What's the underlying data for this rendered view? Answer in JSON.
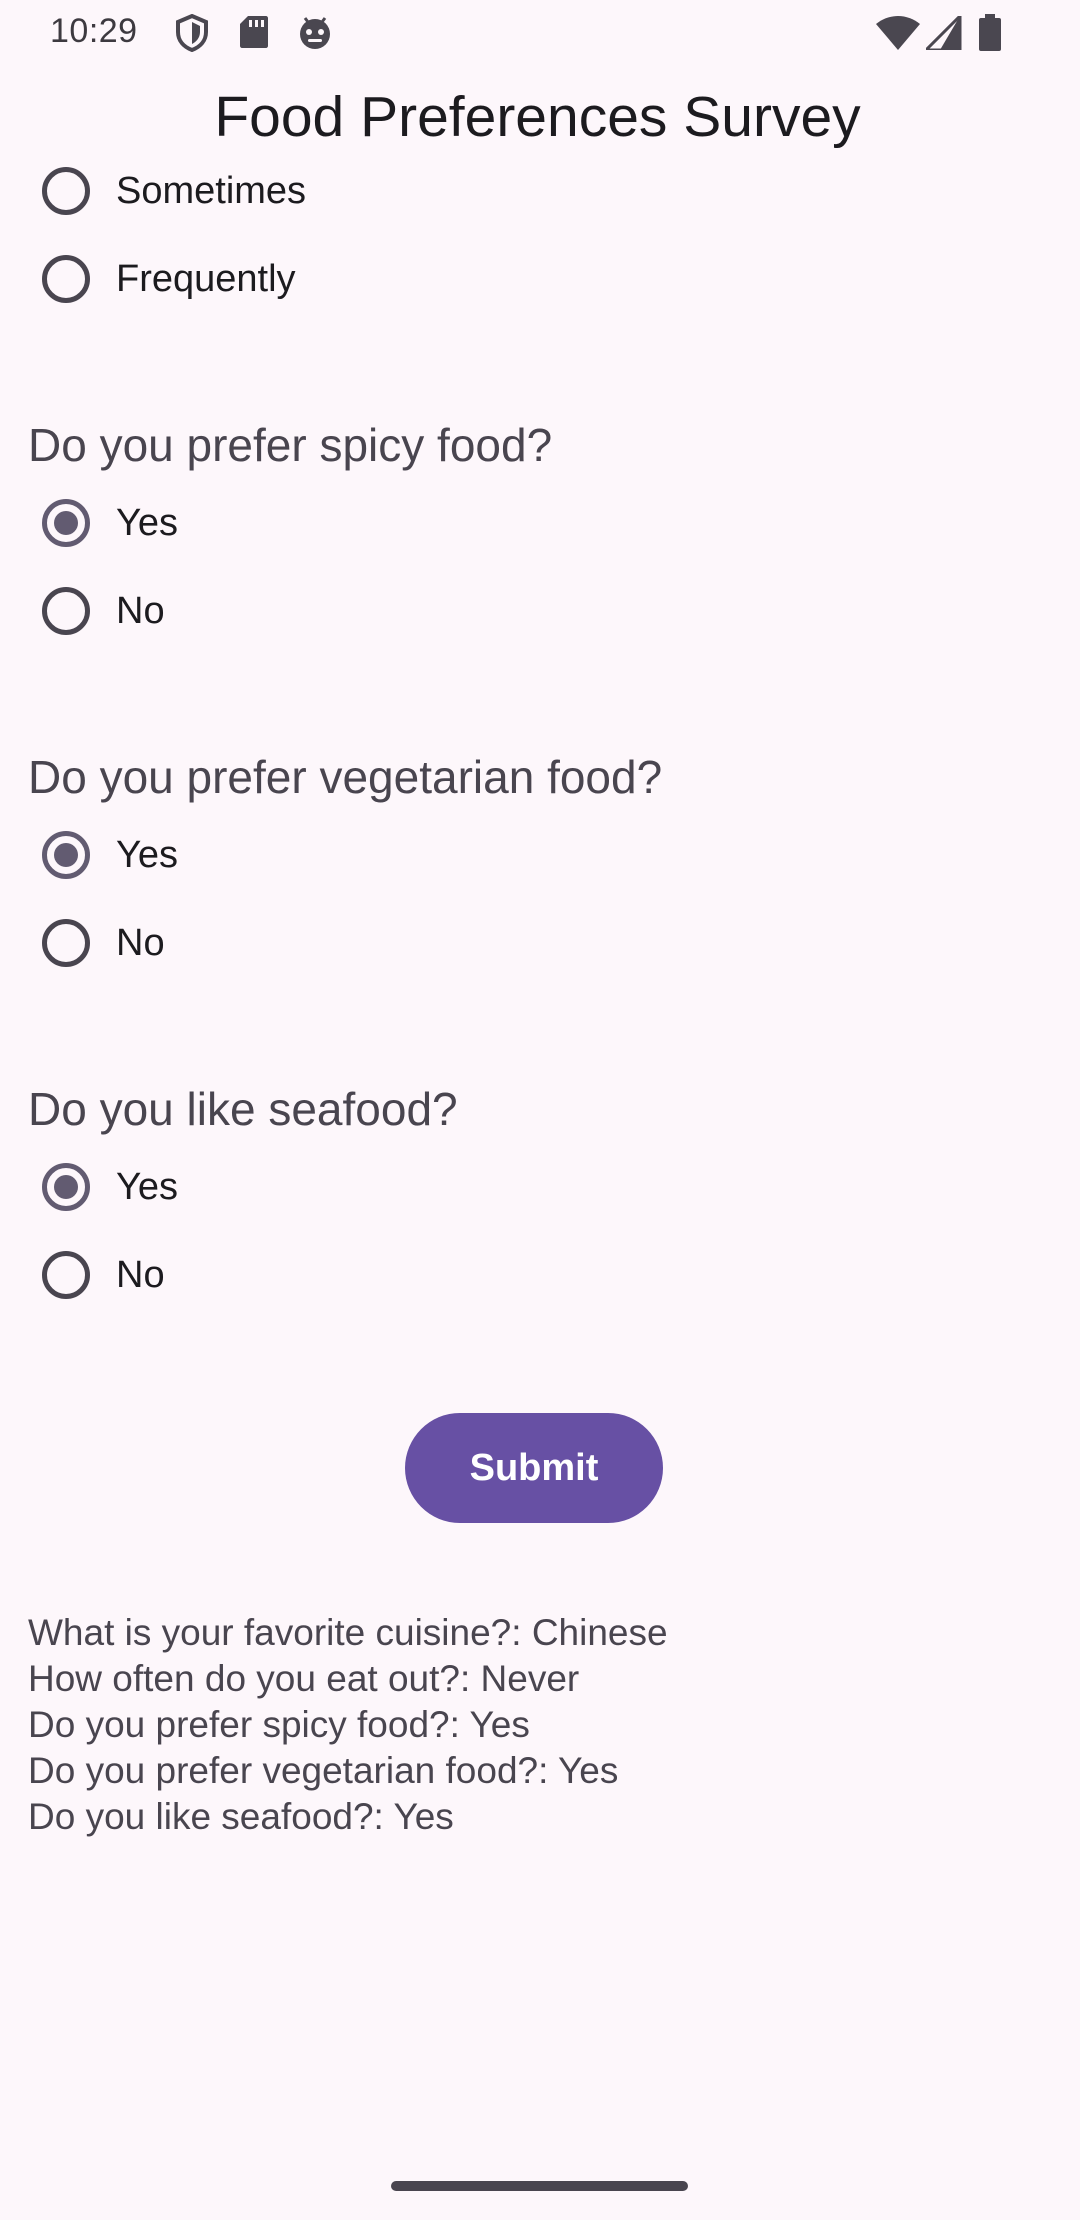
{
  "status_bar": {
    "time": "10:29",
    "left_icons": [
      "shield-icon",
      "sd-card-icon",
      "android-debug-icon"
    ],
    "right_icons": [
      "wifi-icon",
      "cell-signal-icon",
      "battery-icon"
    ]
  },
  "app": {
    "title": "Food Preferences Survey"
  },
  "questions": [
    {
      "text": "",
      "options": [
        {
          "label": "Sometimes",
          "selected": false
        },
        {
          "label": "Frequently",
          "selected": false
        }
      ]
    },
    {
      "text": "Do you prefer spicy food?",
      "options": [
        {
          "label": "Yes",
          "selected": true
        },
        {
          "label": "No",
          "selected": false
        }
      ]
    },
    {
      "text": "Do you prefer vegetarian food?",
      "options": [
        {
          "label": "Yes",
          "selected": true
        },
        {
          "label": "No",
          "selected": false
        }
      ]
    },
    {
      "text": "Do you like seafood?",
      "options": [
        {
          "label": "Yes",
          "selected": true
        },
        {
          "label": "No",
          "selected": false
        }
      ]
    }
  ],
  "submit": {
    "label": "Submit"
  },
  "results": [
    "What is your favorite cuisine?: Chinese",
    "How often do you eat out?: Never",
    "Do you prefer spicy food?: Yes",
    "Do you prefer vegetarian food?: Yes",
    "Do you like seafood?: Yes"
  ],
  "colors": {
    "background": "#fdf7fb",
    "primary": "#6750a4",
    "radio_selected": "#625b71",
    "radio_unselected": "#49454f"
  }
}
